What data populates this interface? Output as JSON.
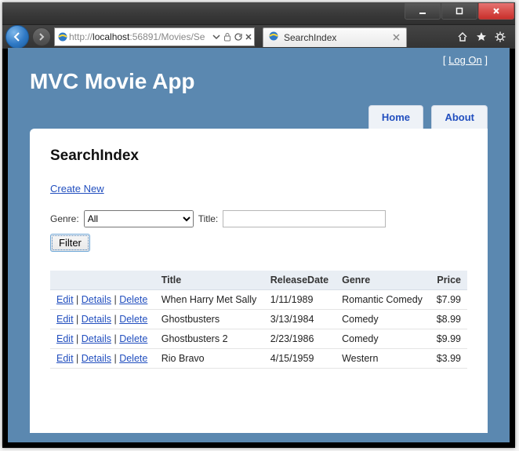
{
  "window": {
    "address_scheme": "http://",
    "address_host": "localhost",
    "address_path": ":56891/Movies/Se",
    "tab_title": "SearchIndex"
  },
  "header": {
    "logon_label": "Log On",
    "app_title": "MVC Movie App",
    "nav": {
      "home": "Home",
      "about": "About"
    }
  },
  "main": {
    "page_heading": "SearchIndex",
    "create_link": "Create New",
    "genre_label": "Genre:",
    "genre_selected": "All",
    "title_label": "Title:",
    "title_value": "",
    "filter_label": "Filter"
  },
  "table": {
    "headers": {
      "actions": "",
      "title": "Title",
      "releasedate": "ReleaseDate",
      "genre": "Genre",
      "price": "Price"
    },
    "action_labels": {
      "edit": "Edit",
      "details": "Details",
      "delete": "Delete"
    },
    "rows": [
      {
        "title": "When Harry Met Sally",
        "releasedate": "1/11/1989",
        "genre": "Romantic Comedy",
        "price": "$7.99"
      },
      {
        "title": "Ghostbusters",
        "releasedate": "3/13/1984",
        "genre": "Comedy",
        "price": "$8.99"
      },
      {
        "title": "Ghostbusters 2",
        "releasedate": "2/23/1986",
        "genre": "Comedy",
        "price": "$9.99"
      },
      {
        "title": "Rio Bravo",
        "releasedate": "4/15/1959",
        "genre": "Western",
        "price": "$3.99"
      }
    ]
  }
}
